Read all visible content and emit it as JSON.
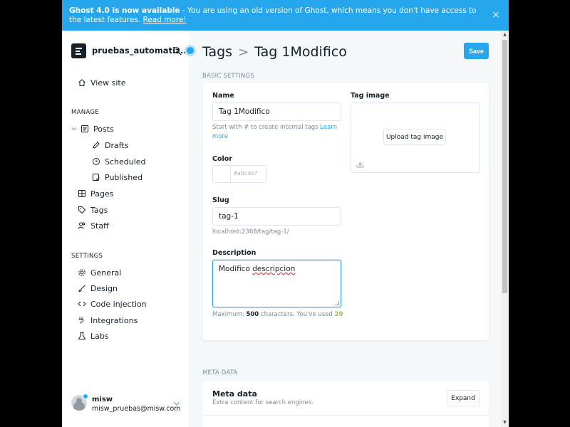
{
  "banner": {
    "title": "Ghost 4.0 is now available",
    "message": " - You are using an old version of Ghost, which means you don't have access to the latest features. ",
    "link": "Read more!",
    "close": "×"
  },
  "sidebar": {
    "site_name": "pruebas_automatiz...",
    "view_site": "View site",
    "manage_heading": "MANAGE",
    "posts": "Posts",
    "drafts": "Drafts",
    "scheduled": "Scheduled",
    "published": "Published",
    "pages": "Pages",
    "tags": "Tags",
    "staff": "Staff",
    "settings_heading": "SETTINGS",
    "general": "General",
    "design": "Design",
    "code_injection": "Code injection",
    "integrations": "Integrations",
    "labs": "Labs",
    "user_name": "misw",
    "user_email": "misw_pruebas@misw.com"
  },
  "header": {
    "crumb_parent": "Tags",
    "separator": ">",
    "crumb_current": "Tag 1Modifico",
    "save_label": "Save"
  },
  "form": {
    "basic_settings": "BASIC SETTINGS",
    "name_label": "Name",
    "name_value": "Tag 1Modifico",
    "name_help": "Start with # to create internal tags ",
    "name_help_link": "Learn more",
    "color_label": "Color",
    "color_placeholder": "abcdef",
    "color_hash": "#",
    "slug_label": "Slug",
    "slug_value": "tag-1",
    "slug_url": "localhost:2368/tag/tag-1/",
    "description_label": "Description",
    "description_word1": "Modifico",
    "description_word2": "descripcion",
    "count_prefix": "Maximum: ",
    "count_max": "500",
    "count_mid": " characters. You've used ",
    "count_used": "20",
    "tag_image_label": "Tag image",
    "upload_label": "Upload tag image"
  },
  "meta": {
    "section": "META DATA",
    "title": "Meta data",
    "subtitle": "Extra content for search engines.",
    "expand_label": "Expand"
  },
  "colors": {
    "accent": "#26a6ed",
    "text": "#15212a",
    "muted": "#7c8b9a",
    "count_green": "#9fbb58"
  }
}
